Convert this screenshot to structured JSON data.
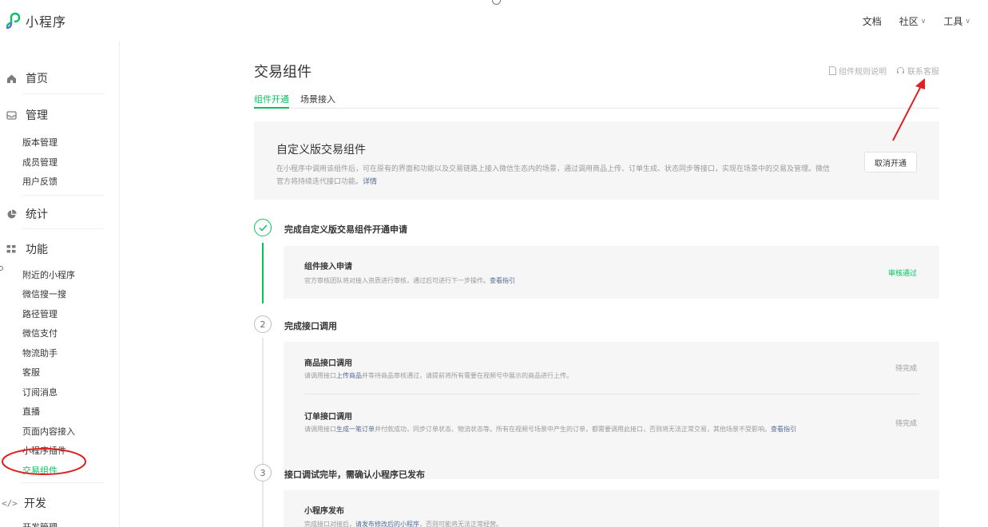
{
  "app": {
    "title": "小程序"
  },
  "topnav": {
    "docs": "文档",
    "community": "社区",
    "tools": "工具"
  },
  "sidebar": {
    "home": "首页",
    "manage": {
      "label": "管理",
      "items": [
        "版本管理",
        "成员管理",
        "用户反馈"
      ]
    },
    "stats": "统计",
    "features": {
      "label": "功能",
      "items": [
        "附近的小程序",
        "微信搜一搜",
        "路径管理",
        "微信支付",
        "物流助手",
        "客服",
        "订阅消息",
        "直播",
        "页面内容接入",
        "小程序插件",
        "交易组件"
      ],
      "active_index": 10
    },
    "develop": {
      "label": "开发",
      "items": [
        "开发管理"
      ]
    }
  },
  "main": {
    "title": "交易组件",
    "links": {
      "rules": "组件规则说明",
      "contact": "联系客服"
    },
    "tabs": [
      "组件开通",
      "场景接入"
    ],
    "active_tab": 0,
    "card": {
      "title": "自定义版交易组件",
      "desc": "在小程序中调用该组件后，可在原有的界面和功能以及交易链路上接入微信生态内的场景，通过调用商品上传、订单生成、状态同步等接口，实现在场景中的交易及管理。微信官方将持续迭代接口功能。",
      "desc_link": "详情",
      "button": "取消开通"
    },
    "steps": [
      {
        "num": "1",
        "title": "完成自定义版交易组件开通申请",
        "status": "done",
        "tasks": [
          {
            "name": "组件接入申请",
            "desc": "官方审核团队将对接入资质进行审核，通过后可进行下一步操作。",
            "link": "查看指引",
            "status": "审核通过"
          }
        ]
      },
      {
        "num": "2",
        "title": "完成接口调用",
        "status": "pending",
        "tasks": [
          {
            "name": "商品接口调用",
            "desc_pre": "请调用接口",
            "desc_link": "上传商品",
            "desc_post": "并等待商品审核通过，请提前将所有需要在视频号中展示的商品进行上传。",
            "status": "待完成"
          },
          {
            "name": "订单接口调用",
            "desc_pre": "请调用接口",
            "desc_link": "生成一笔订单",
            "desc_post": "并付款成功，同步订单状态、物流状态等。所有在视频号场景中产生的订单，都需要调用此接口，否则将无法正常交易，其他场景不受影响。",
            "link": "查看指引",
            "status": "待完成"
          }
        ]
      },
      {
        "num": "3",
        "title": "接口调试完毕，需确认小程序已发布",
        "status": "pending",
        "tasks": [
          {
            "name": "小程序发布",
            "desc_pre": "完成接口对接后，",
            "desc_link": "请发布修改后的小程序",
            "desc_post": "，否则可能将无法正常经营。"
          }
        ]
      }
    ]
  },
  "colors": {
    "accent": "#07c160",
    "link": "#576b95",
    "annotation": "#e02020"
  }
}
